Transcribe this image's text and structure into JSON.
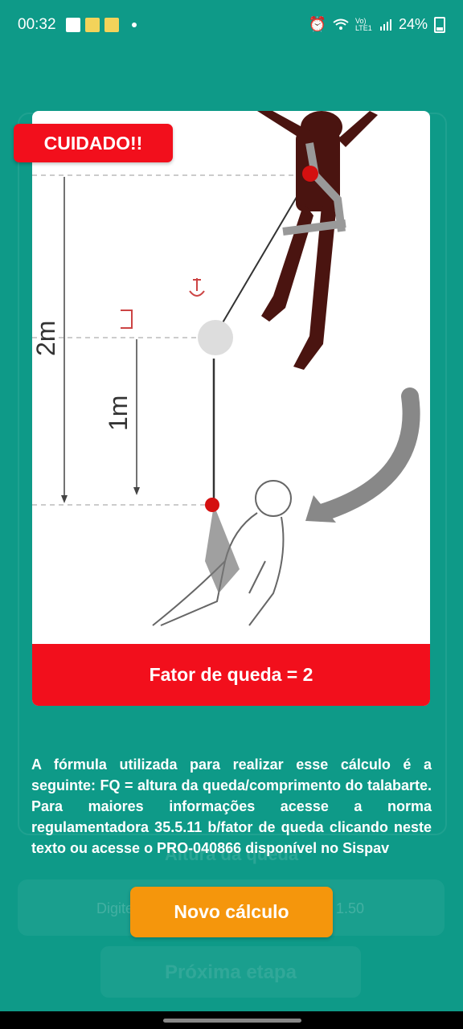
{
  "status_bar": {
    "time": "00:32",
    "signal_label": "Vo) LTE1",
    "battery": "24%"
  },
  "background_screen": {
    "field_label": "Altura da queda",
    "input_placeholder": "Digite",
    "input_value": "1.50",
    "next_button": "Próxima etapa"
  },
  "dialog": {
    "warning_badge": "CUIDADO!!",
    "illustration": {
      "height_label_total": "2m",
      "height_label_lanyard": "1m"
    },
    "result_text": "Fator de queda = 2",
    "info_text": "A fórmula utilizada para realizar esse cálculo é a seguinte: FQ = altura da queda/comprimento do talabarte. Para maiores informações acesse a norma regulamentadora 35.5.11 b/fator de queda clicando neste texto ou acesse o PRO-040866 disponível no Sispav",
    "new_calc_button": "Novo cálculo"
  },
  "colors": {
    "background": "#0e9a88",
    "alert_red": "#f20f1c",
    "button_orange": "#f5960c"
  }
}
